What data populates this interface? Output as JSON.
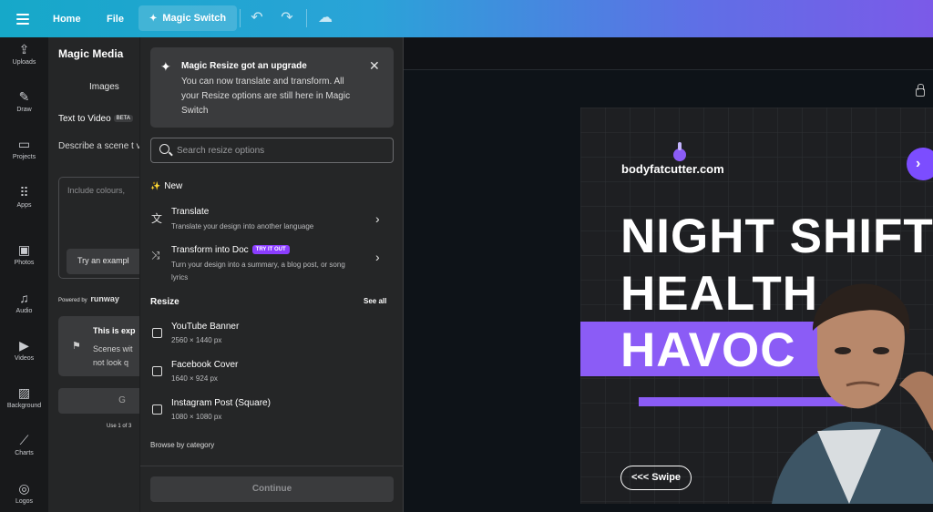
{
  "topbar": {
    "home": "Home",
    "file": "File",
    "magic_switch": "Magic Switch"
  },
  "rail": {
    "items": [
      {
        "label": "Uploads",
        "icon": "upload-icon"
      },
      {
        "label": "Draw",
        "icon": "draw-icon"
      },
      {
        "label": "Projects",
        "icon": "folder-icon"
      },
      {
        "label": "Apps",
        "icon": "apps-icon"
      },
      {
        "label": "Photos",
        "icon": "photo-icon"
      },
      {
        "label": "Audio",
        "icon": "music-icon"
      },
      {
        "label": "Videos",
        "icon": "video-icon"
      },
      {
        "label": "Background",
        "icon": "background-icon"
      },
      {
        "label": "Charts",
        "icon": "chart-icon"
      },
      {
        "label": "Logos",
        "icon": "logo-icon"
      }
    ]
  },
  "panel": {
    "title": "Magic Media",
    "tab": "Images",
    "subtitle": "Text to Video",
    "beta": "BETA",
    "description": "Describe a scene t video.",
    "textarea_placeholder": "Include colours,",
    "try_example": "Try an exampl",
    "powered_by": "Powered by",
    "powered_brand": "runway",
    "info_title": "This is exp",
    "info_line1": "Scenes wit",
    "info_line2": "not look q",
    "generate": "G",
    "usage": "Use 1 of 3"
  },
  "dropdown": {
    "upgrade_title": "Magic Resize got an upgrade",
    "upgrade_body": "You can now translate and transform. All your Resize options are still here in Magic Switch",
    "search_placeholder": "Search resize options",
    "new_label": "New",
    "translate_title": "Translate",
    "translate_desc": "Translate your design into another language",
    "transform_title": "Transform into Doc",
    "transform_badge": "TRY IT OUT",
    "transform_desc": "Turn your design into a summary, a blog post, or song lyrics",
    "resize_label": "Resize",
    "see_all": "See all",
    "resize_options": [
      {
        "title": "YouTube Banner",
        "dims": "2560 × 1440 px"
      },
      {
        "title": "Facebook Cover",
        "dims": "1640 × 924 px"
      },
      {
        "title": "Instagram Post (Square)",
        "dims": "1080 × 1080 px"
      }
    ],
    "browse_label": "Browse by category",
    "continue_label": "Continue"
  },
  "design": {
    "brand": "bodyfatcutter.com",
    "line1": "NIGHT SHIFT",
    "line2": "HEALTH",
    "line3": "HAVOC",
    "swipe": "<<< Swipe",
    "arrow": "›",
    "accent_color": "#8b5cf6",
    "background_color": "#1e1f22"
  }
}
